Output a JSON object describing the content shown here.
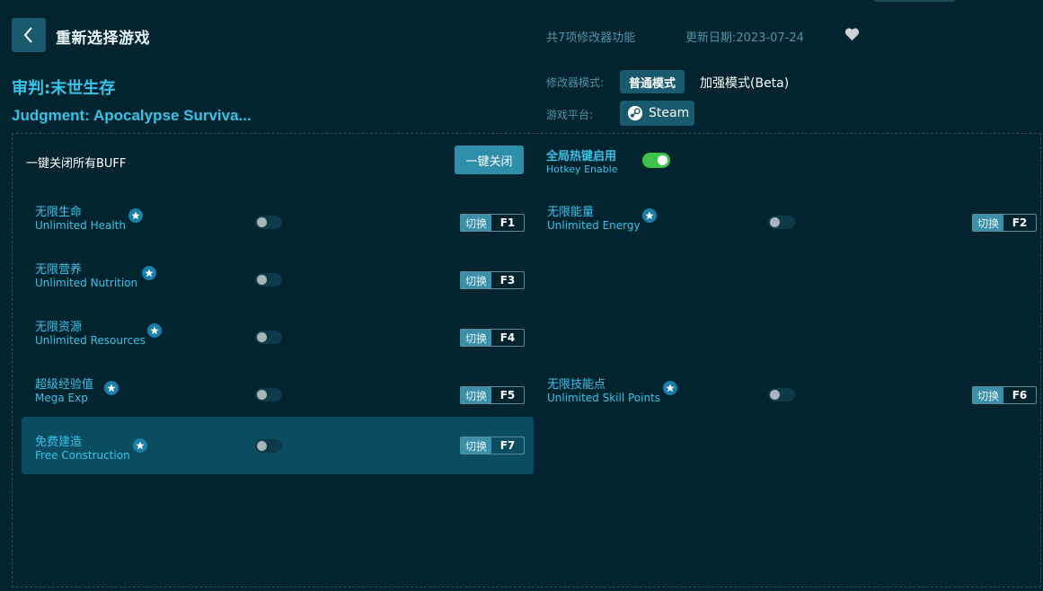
{
  "header": {
    "back_icon": "chevron-left-icon",
    "title": "重新选择游戏",
    "feature_count": "共7项修改器功能",
    "update_date": "更新日期:2023-07-24",
    "favorite_icon": "heart-icon"
  },
  "game": {
    "name_cn": "审判:末世生存",
    "name_en": "Judgment: Apocalypse Surviva..."
  },
  "mode": {
    "label": "修改器模式:",
    "normal": "普通模式",
    "beta": "加强模式(Beta)"
  },
  "platform": {
    "label": "游戏平台:",
    "name": "Steam",
    "icon": "steam-icon"
  },
  "controls": {
    "all_buff_label": "一键关闭所有BUFF",
    "all_buff_button": "一键关闭",
    "hotkey_cn": "全局热键启用",
    "hotkey_en": "Hotkey Enable",
    "hotkey_enabled": true
  },
  "switch_label": "切换",
  "options": [
    {
      "cn": "无限生命",
      "en": "Unlimited Health",
      "key": "F1",
      "enabled": false
    },
    {
      "cn": "无限能量",
      "en": "Unlimited Energy",
      "key": "F2",
      "enabled": false
    },
    {
      "cn": "无限营养",
      "en": "Unlimited Nutrition",
      "key": "F3",
      "enabled": false
    },
    {
      "cn": "无限资源",
      "en": "Unlimited Resources",
      "key": "F4",
      "enabled": false
    },
    {
      "cn": "超级经验值",
      "en": "Mega Exp",
      "key": "F5",
      "enabled": false
    },
    {
      "cn": "无限技能点",
      "en": "Unlimited Skill Points",
      "key": "F6",
      "enabled": false
    },
    {
      "cn": "免费建造",
      "en": "Free Construction",
      "key": "F7",
      "enabled": false
    }
  ],
  "colors": {
    "background": "#02242f",
    "accent": "#36c3ea",
    "button": "#1a5a6e",
    "toggle_on": "#3cc24a"
  }
}
